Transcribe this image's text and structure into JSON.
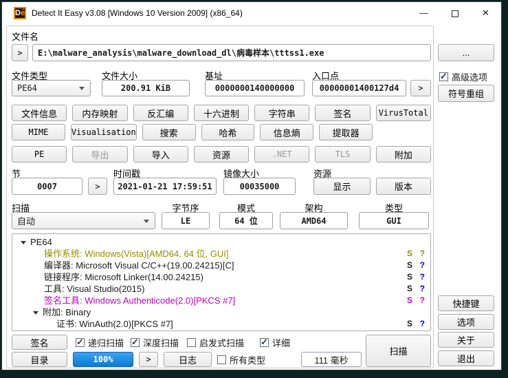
{
  "window": {
    "icon_text_d": "D",
    "icon_text_e": "e",
    "title": "Detect It Easy v3.08 [Windows 10 Version 2009] (x86_64)",
    "controls": {
      "minimize": "—",
      "close": "✕"
    }
  },
  "file": {
    "label": "文件名",
    "goto": ">",
    "path": "E:\\malware_analysis\\malware_download_dl\\病毒样本\\tttss1.exe",
    "browse": "..."
  },
  "info": {
    "file_type": {
      "label": "文件类型",
      "value": "PE64"
    },
    "file_size": {
      "label": "文件大小",
      "value": "200.91 KiB"
    },
    "base_address": {
      "label": "基址",
      "value": "0000000140000000"
    },
    "entry_point": {
      "label": "入口点",
      "value": "00000001400127d4",
      "goto": ">"
    }
  },
  "advanced": {
    "label": "高级选项",
    "checked": true,
    "symbol_button": "符号重组"
  },
  "toolbar": {
    "rowA": [
      "文件信息",
      "内存映射",
      "反汇编",
      "十六进制",
      "字符串",
      "签名",
      "VirusTotal"
    ],
    "rowB": [
      "MIME",
      "Visualisation",
      "搜索",
      "哈希",
      "信息熵",
      "提取器"
    ],
    "rowC": [
      {
        "label": "PE",
        "enabled": true
      },
      {
        "label": "导出",
        "enabled": false
      },
      {
        "label": "导入",
        "enabled": true
      },
      {
        "label": "资源",
        "enabled": true
      },
      {
        "label": ".NET",
        "enabled": false
      },
      {
        "label": "TLS",
        "enabled": false
      },
      {
        "label": "附加",
        "enabled": true
      }
    ]
  },
  "pe_info": {
    "sections": {
      "label": "节",
      "value": "0007",
      "goto": ">"
    },
    "timestamp": {
      "label": "时间戳",
      "value": "2021-01-21 17:59:51"
    },
    "image_size": {
      "label": "镜像大小",
      "value": "00035000"
    },
    "resources": {
      "label": "资源",
      "show_button": "显示",
      "version_button": "版本"
    }
  },
  "scan_info": {
    "scan": {
      "label": "扫描",
      "value": "自动"
    },
    "endianness": {
      "label": "字节序",
      "value": "LE"
    },
    "mode": {
      "label": "模式",
      "value": "64 位"
    },
    "arch": {
      "label": "架构",
      "value": "AMD64"
    },
    "type": {
      "label": "类型",
      "value": "GUI"
    }
  },
  "results": [
    {
      "text": "PE64",
      "color": "#1a1a1a",
      "expanded": true
    },
    {
      "text": "操作系统: Windows(Vista)[AMD64, 64 位, GUI]",
      "color": "#8f8f00",
      "s": "S",
      "q": "?",
      "q_color": "#8f8f00"
    },
    {
      "text": "编译器: Microsoft Visual C/C++(19.00.24215)[C]",
      "color": "#1a1a1a",
      "s": "S",
      "q": "?",
      "q_color": "#0000e8"
    },
    {
      "text": "链接程序: Microsoft Linker(14.00.24215)",
      "color": "#1a1a1a",
      "s": "S",
      "q": "?",
      "q_color": "#0000e8"
    },
    {
      "text": "工具: Visual Studio(2015)",
      "color": "#1a1a1a",
      "s": "S",
      "q": "?",
      "q_color": "#0000e8"
    },
    {
      "text": "签名工具: Windows Authenticode(2.0)[PKCS #7]",
      "color": "#bf00bf",
      "s": "S",
      "q": "?",
      "q_color": "#bf00bf"
    },
    {
      "text": "附加: Binary",
      "color": "#1a1a1a",
      "expanded": true
    },
    {
      "text": "证书: WinAuth(2.0)[PKCS #7]",
      "color": "#1a1a1a",
      "s": "S",
      "q": "?",
      "q_color": "#0000e8"
    }
  ],
  "footer": {
    "signatures_button": "签名",
    "checkboxes": [
      {
        "label": "递归扫描",
        "checked": true
      },
      {
        "label": "深度扫描",
        "checked": true
      },
      {
        "label": "启发式扫描",
        "checked": false
      },
      {
        "label": "详细",
        "checked": true
      }
    ],
    "directory_button": "目录",
    "progress": "100%",
    "goto": ">",
    "log_button": "日志",
    "all_types": {
      "label": "所有类型",
      "checked": false
    },
    "duration": "111 毫秒",
    "scan_button": "扫描"
  },
  "side_buttons": {
    "shortcuts": "快捷键",
    "options": "选项",
    "about": "关于",
    "exit": "退出"
  },
  "colors": {
    "progress_blue": "#0c79d5",
    "os_olive": "#8f8f00",
    "sign_magenta": "#bf00bf",
    "link_blue": "#0000e8"
  }
}
